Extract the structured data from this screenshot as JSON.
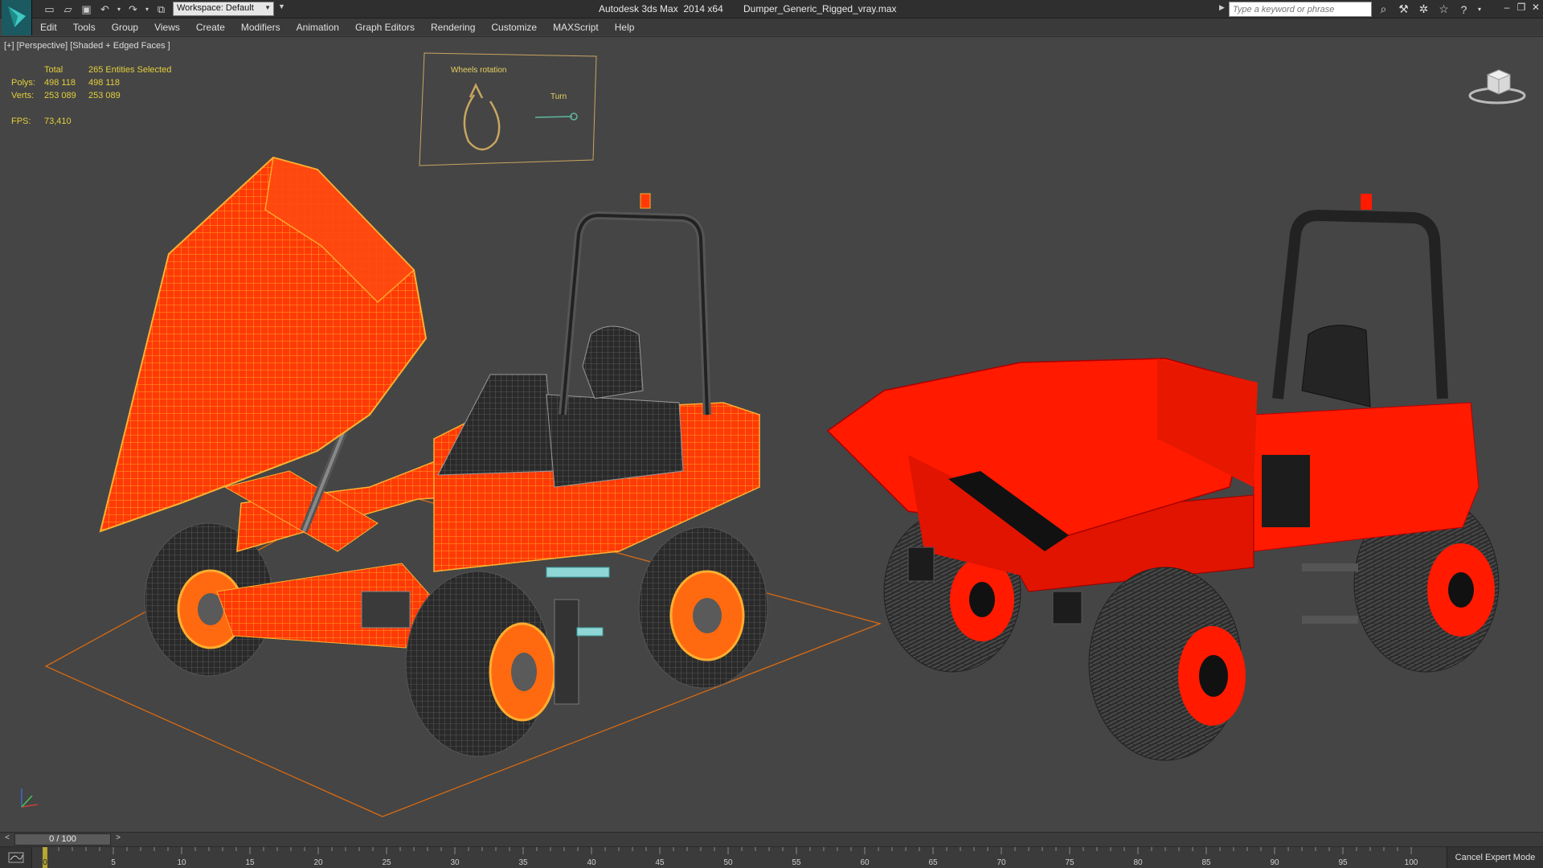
{
  "titlebar": {
    "workspace_label": "Workspace: Default",
    "app_title": "Autodesk 3ds Max  2014 x64",
    "file_name": "Dumper_Generic_Rigged_vray.max",
    "search_placeholder": "Type a keyword or phrase"
  },
  "menu": [
    "Edit",
    "Tools",
    "Group",
    "Views",
    "Create",
    "Modifiers",
    "Animation",
    "Graph Editors",
    "Rendering",
    "Customize",
    "MAXScript",
    "Help"
  ],
  "viewport": {
    "label": "[+] [Perspective] [Shaded + Edged Faces ]",
    "stats": {
      "header_total": "Total",
      "header_selected": "265 Entities Selected",
      "polys_label": "Polys:",
      "polys_total": "498 118",
      "polys_selected": "498 118",
      "verts_label": "Verts:",
      "verts_total": "253 089",
      "verts_selected": "253 089",
      "fps_label": "FPS:",
      "fps_value": "73,410"
    },
    "control_panel": {
      "title": "Wheels rotation",
      "turn_label": "Turn"
    }
  },
  "timeline": {
    "frame_display": "0 / 100",
    "current_frame": 0,
    "ticks": [
      "0",
      "5",
      "10",
      "15",
      "20",
      "25",
      "30",
      "35",
      "40",
      "45",
      "50",
      "55",
      "60",
      "65",
      "70",
      "75",
      "80",
      "85",
      "90",
      "95",
      "100"
    ]
  },
  "status": {
    "cancel_expert_mode": "Cancel Expert Mode"
  },
  "colors": {
    "wireframe_orange": "#ff8c1a",
    "body_red": "#ff2200",
    "stats_yellow": "#e3cf3c",
    "viewport_bg": "#454545"
  }
}
